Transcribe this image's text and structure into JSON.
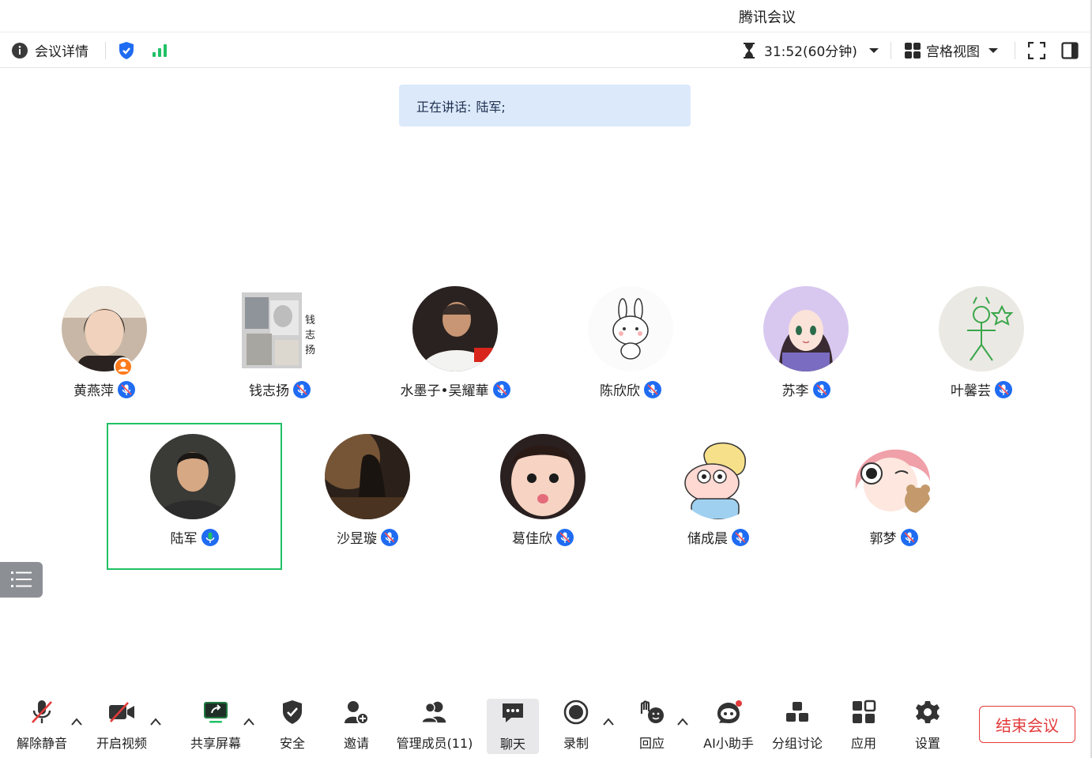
{
  "window": {
    "title": "腾讯会议"
  },
  "topbar": {
    "meeting_details_label": "会议详情",
    "timer_text": "31:52(60分钟)",
    "view_label": "宫格视图"
  },
  "speaking": {
    "prefix": "正在讲话:",
    "names": "陆军;"
  },
  "participants_row1": [
    {
      "name": "黄燕萍",
      "is_host": true
    },
    {
      "name": "钱志扬"
    },
    {
      "name": "水墨子•吴耀華"
    },
    {
      "name": "陈欣欣"
    },
    {
      "name": "苏李"
    },
    {
      "name": "叶馨芸"
    }
  ],
  "participants_row2": [
    {
      "name": "陆军",
      "speaking": true
    },
    {
      "name": "沙昱璇"
    },
    {
      "name": "葛佳欣"
    },
    {
      "name": "储成晨"
    },
    {
      "name": "郭梦"
    }
  ],
  "avatar_text": {
    "qian_zhiyang": [
      "钱",
      "志",
      "扬"
    ]
  },
  "toolbar": {
    "unmute": "解除静音",
    "start_video": "开启视频",
    "share_screen": "共享屏幕",
    "security": "安全",
    "invite": "邀请",
    "manage_members": "管理成员(11)",
    "chat": "聊天",
    "record": "录制",
    "react": "回应",
    "ai_assistant": "AI小助手",
    "breakout": "分组讨论",
    "apps": "应用",
    "settings": "设置",
    "end_meeting": "结束会议"
  },
  "colors": {
    "accent_blue": "#1f6cf2",
    "speaking_green": "#20c164",
    "end_red": "#e23b3b",
    "speaking_banner_bg": "#dce9fb",
    "host_orange": "#ff7a1a"
  }
}
